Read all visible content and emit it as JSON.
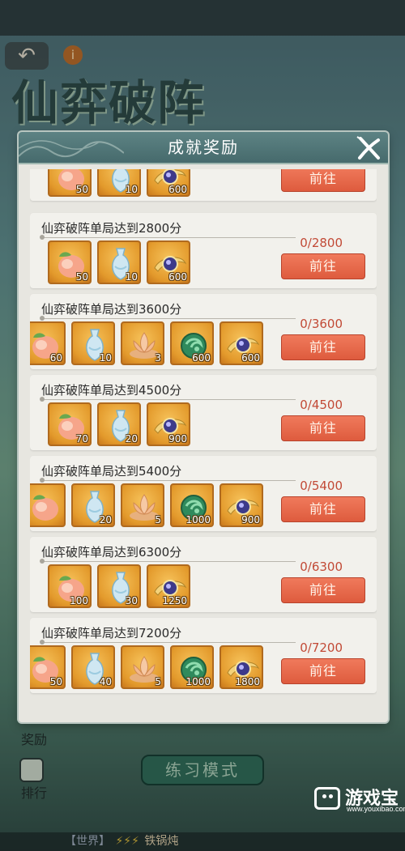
{
  "background": {
    "title": "仙弈破阵",
    "back_icon": "back-arrow-icon",
    "info_icon": "info-icon",
    "left_labels": [
      "奖励",
      "排行"
    ],
    "practice_button": "练习模式",
    "chat": {
      "channel": "【世界】",
      "name": "铁锅炖"
    }
  },
  "watermark": {
    "name": "游戏宝",
    "url": "www.youxibao.com"
  },
  "modal": {
    "title": "成就奖励",
    "close_icon": "close-x-icon",
    "go_label": "前往",
    "achievements": [
      {
        "title": "",
        "progress": "",
        "partial": true,
        "rewards": [
          {
            "icon": "peach-icon",
            "qty": "50"
          },
          {
            "icon": "vase-icon",
            "qty": "10"
          },
          {
            "icon": "orb-icon",
            "qty": "600"
          }
        ]
      },
      {
        "title": "仙弈破阵单局达到2800分",
        "progress": "0/2800",
        "rewards": [
          {
            "icon": "peach-icon",
            "qty": "50"
          },
          {
            "icon": "vase-icon",
            "qty": "10"
          },
          {
            "icon": "orb-icon",
            "qty": "600"
          }
        ]
      },
      {
        "title": "仙弈破阵单局达到3600分",
        "progress": "0/3600",
        "scrolled": true,
        "rewards": [
          {
            "icon": "peach-icon",
            "qty": "60"
          },
          {
            "icon": "vase-icon",
            "qty": "10"
          },
          {
            "icon": "lotus-icon",
            "qty": "3"
          },
          {
            "icon": "jade-dragon-icon",
            "qty": "600"
          },
          {
            "icon": "orb-icon",
            "qty": "600"
          }
        ]
      },
      {
        "title": "仙弈破阵单局达到4500分",
        "progress": "0/4500",
        "rewards": [
          {
            "icon": "peach-icon",
            "qty": "70"
          },
          {
            "icon": "vase-icon",
            "qty": "20"
          },
          {
            "icon": "orb-icon",
            "qty": "900"
          }
        ]
      },
      {
        "title": "仙弈破阵单局达到5400分",
        "progress": "0/5400",
        "scrolled": true,
        "rewards": [
          {
            "icon": "peach-icon",
            "qty": ""
          },
          {
            "icon": "vase-icon",
            "qty": "20"
          },
          {
            "icon": "lotus-icon",
            "qty": "5"
          },
          {
            "icon": "jade-dragon-icon",
            "qty": "1000"
          },
          {
            "icon": "orb-icon",
            "qty": "900"
          }
        ]
      },
      {
        "title": "仙弈破阵单局达到6300分",
        "progress": "0/6300",
        "rewards": [
          {
            "icon": "peach-icon",
            "qty": "100"
          },
          {
            "icon": "vase-icon",
            "qty": "30"
          },
          {
            "icon": "orb-icon",
            "qty": "1250"
          }
        ]
      },
      {
        "title": "仙弈破阵单局达到7200分",
        "progress": "0/7200",
        "scrolled": true,
        "rewards": [
          {
            "icon": "peach-icon",
            "qty": "50"
          },
          {
            "icon": "vase-icon",
            "qty": "40"
          },
          {
            "icon": "lotus-icon",
            "qty": "5"
          },
          {
            "icon": "jade-dragon-icon",
            "qty": "1000"
          },
          {
            "icon": "orb-icon",
            "qty": "1800"
          }
        ]
      }
    ]
  }
}
